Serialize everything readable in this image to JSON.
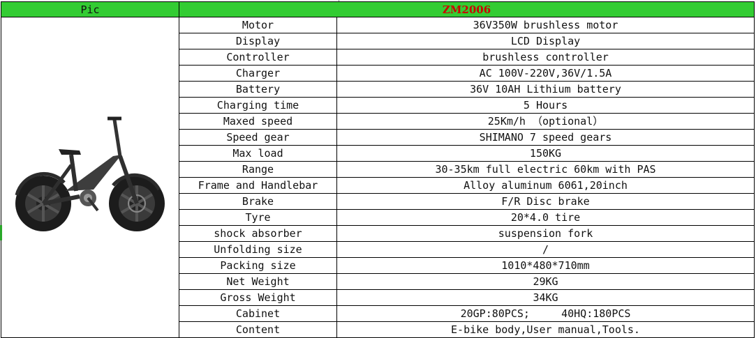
{
  "header": {
    "pic_label": "Pic",
    "model": "ZM2006"
  },
  "specs": [
    {
      "label": "Motor",
      "value": "36V350W brushless motor"
    },
    {
      "label": "Display",
      "value": "LCD Display"
    },
    {
      "label": "Controller",
      "value": "brushless controller"
    },
    {
      "label": "Charger",
      "value": "AC 100V-220V,36V/1.5A"
    },
    {
      "label": "Battery",
      "value": "36V 10AH Lithium battery"
    },
    {
      "label": "Charging time",
      "value": "5 Hours"
    },
    {
      "label": "Maxed speed",
      "value": "25Km/h （optional）"
    },
    {
      "label": "Speed gear",
      "value": "SHIMANO 7 speed gears"
    },
    {
      "label": "Max load",
      "value": "150KG"
    },
    {
      "label": "Range",
      "value": "30-35km full electric 60km with PAS"
    },
    {
      "label": "Frame and Handlebar",
      "value": "Alloy aluminum 6061,20inch"
    },
    {
      "label": "Brake",
      "value": "F/R Disc brake"
    },
    {
      "label": "Tyre",
      "value": "20*4.0 tire"
    },
    {
      "label": "shock absorber",
      "value": "suspension fork"
    },
    {
      "label": "Unfolding size",
      "value": "/"
    },
    {
      "label": "Packing size",
      "value": "1010*480*710mm"
    },
    {
      "label": "Net Weight",
      "value": "29KG"
    },
    {
      "label": "Gross Weight",
      "value": "34KG"
    },
    {
      "label": "Cabinet",
      "value": "20GP:80PCS;     40HQ:180PCS"
    },
    {
      "label": "Content",
      "value": "E-bike body,User manual,Tools."
    }
  ],
  "colors": {
    "header_bg": "#33cc33",
    "model_text": "#cc0000",
    "grid": "#000000"
  },
  "image": {
    "icon": "folding-fat-tire-ebike-photo"
  }
}
